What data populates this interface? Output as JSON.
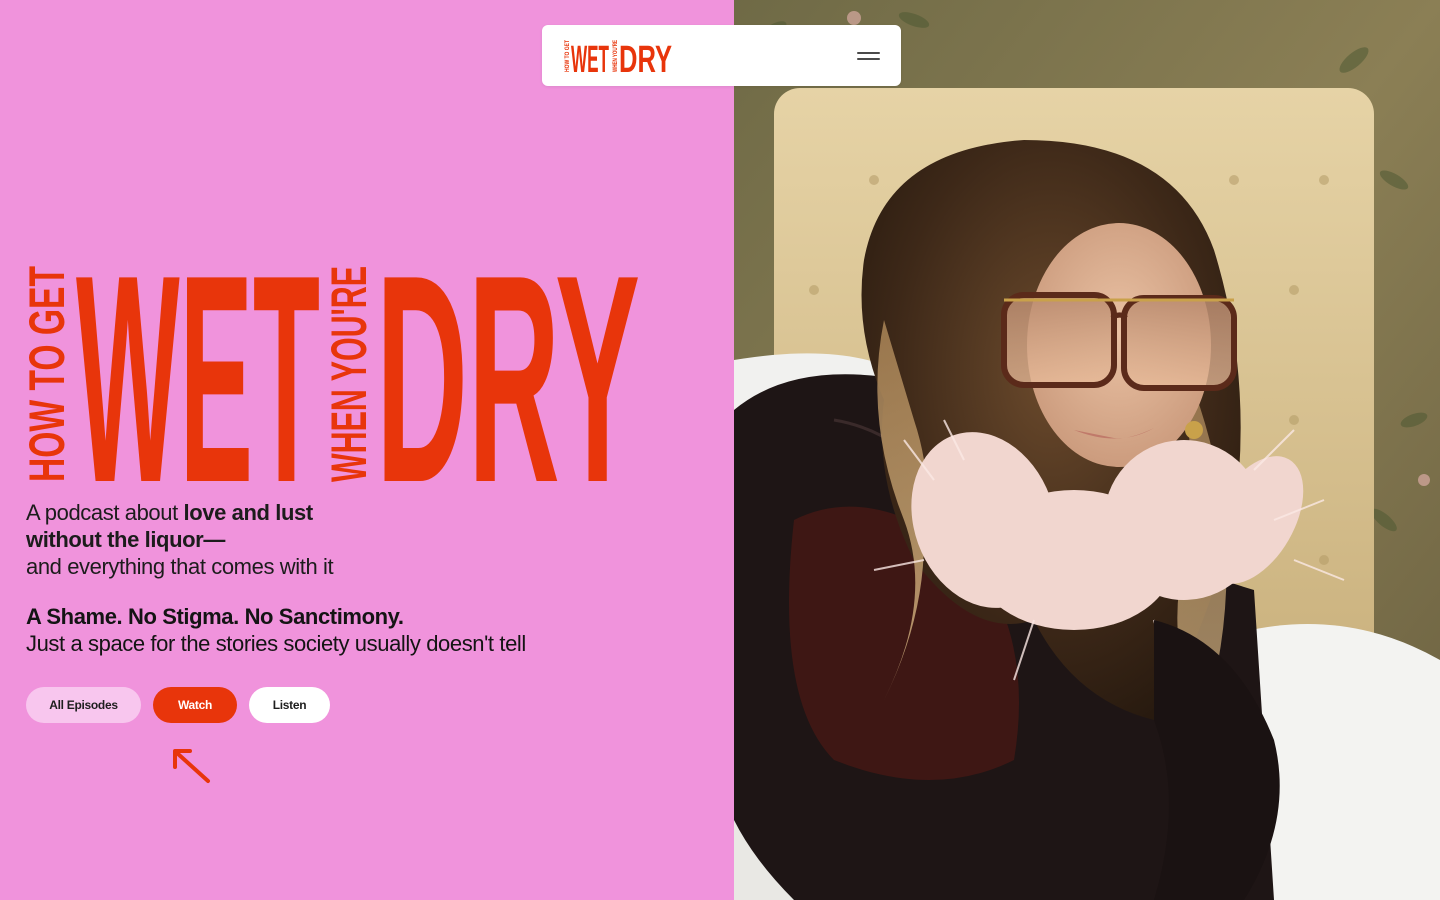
{
  "header": {
    "logo": {
      "line1": "HOW TO GET",
      "word1": "WET",
      "line2": "WHEN YOU'RE",
      "word2": "DRY"
    },
    "menu_icon": "hamburger-menu-icon"
  },
  "hero": {
    "title": {
      "small1": "HOW TO GET",
      "big1": "WET",
      "small2": "WHEN YOU'RE",
      "big2": "DRY"
    },
    "tagline": {
      "part1": "A podcast about ",
      "part1_bold": "love and lust",
      "line2_bold": "without the liquor—",
      "line3": "and everything that comes with it"
    },
    "manifesto": {
      "headline": "A Shame. No Stigma. No Sanctimony.",
      "sub": "Just a space for the stories society usually doesn't tell"
    },
    "buttons": {
      "episodes": "All Episodes",
      "watch": "Watch",
      "listen": "Listen"
    },
    "arrow_icon": "arrow-up-left-icon"
  },
  "photo": {
    "subject": "woman-in-tinted-glasses-feather-collar-on-bed"
  },
  "colors": {
    "background": "#f093dc",
    "brand_red": "#e8350b",
    "episodes_button": "#f8c6ee",
    "text": "#141414"
  }
}
